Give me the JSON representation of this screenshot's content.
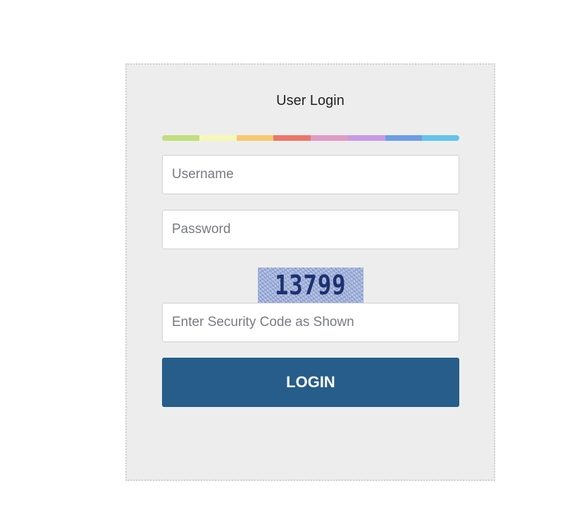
{
  "login": {
    "title": "User Login",
    "username_placeholder": "Username",
    "password_placeholder": "Password",
    "captcha_code": "13799",
    "security_code_placeholder": "Enter Security Code as Shown",
    "button_label": "LOGIN"
  },
  "colors": {
    "button": "#265d8a",
    "panel_background": "#ededed",
    "color_bar": [
      "#c3de7c",
      "#f5f8b7",
      "#f8c86f",
      "#ec7668",
      "#e19bc5",
      "#c89ae3",
      "#6c9ee4",
      "#63c3eb"
    ]
  }
}
